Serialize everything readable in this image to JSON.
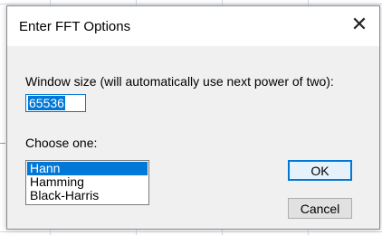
{
  "dialog": {
    "title": "Enter FFT Options",
    "close_glyph": "✕"
  },
  "window_size": {
    "label": "Window size (will automatically use next power of two):",
    "value": "65536"
  },
  "choose": {
    "label": "Choose one:",
    "options": [
      "Hann",
      "Hamming",
      "Black-Harris"
    ],
    "selected": "Hann"
  },
  "buttons": {
    "ok_label": "OK",
    "cancel_label": "Cancel"
  },
  "colors": {
    "accent": "#0078d7",
    "dialog_bg": "#f0f0f0"
  }
}
